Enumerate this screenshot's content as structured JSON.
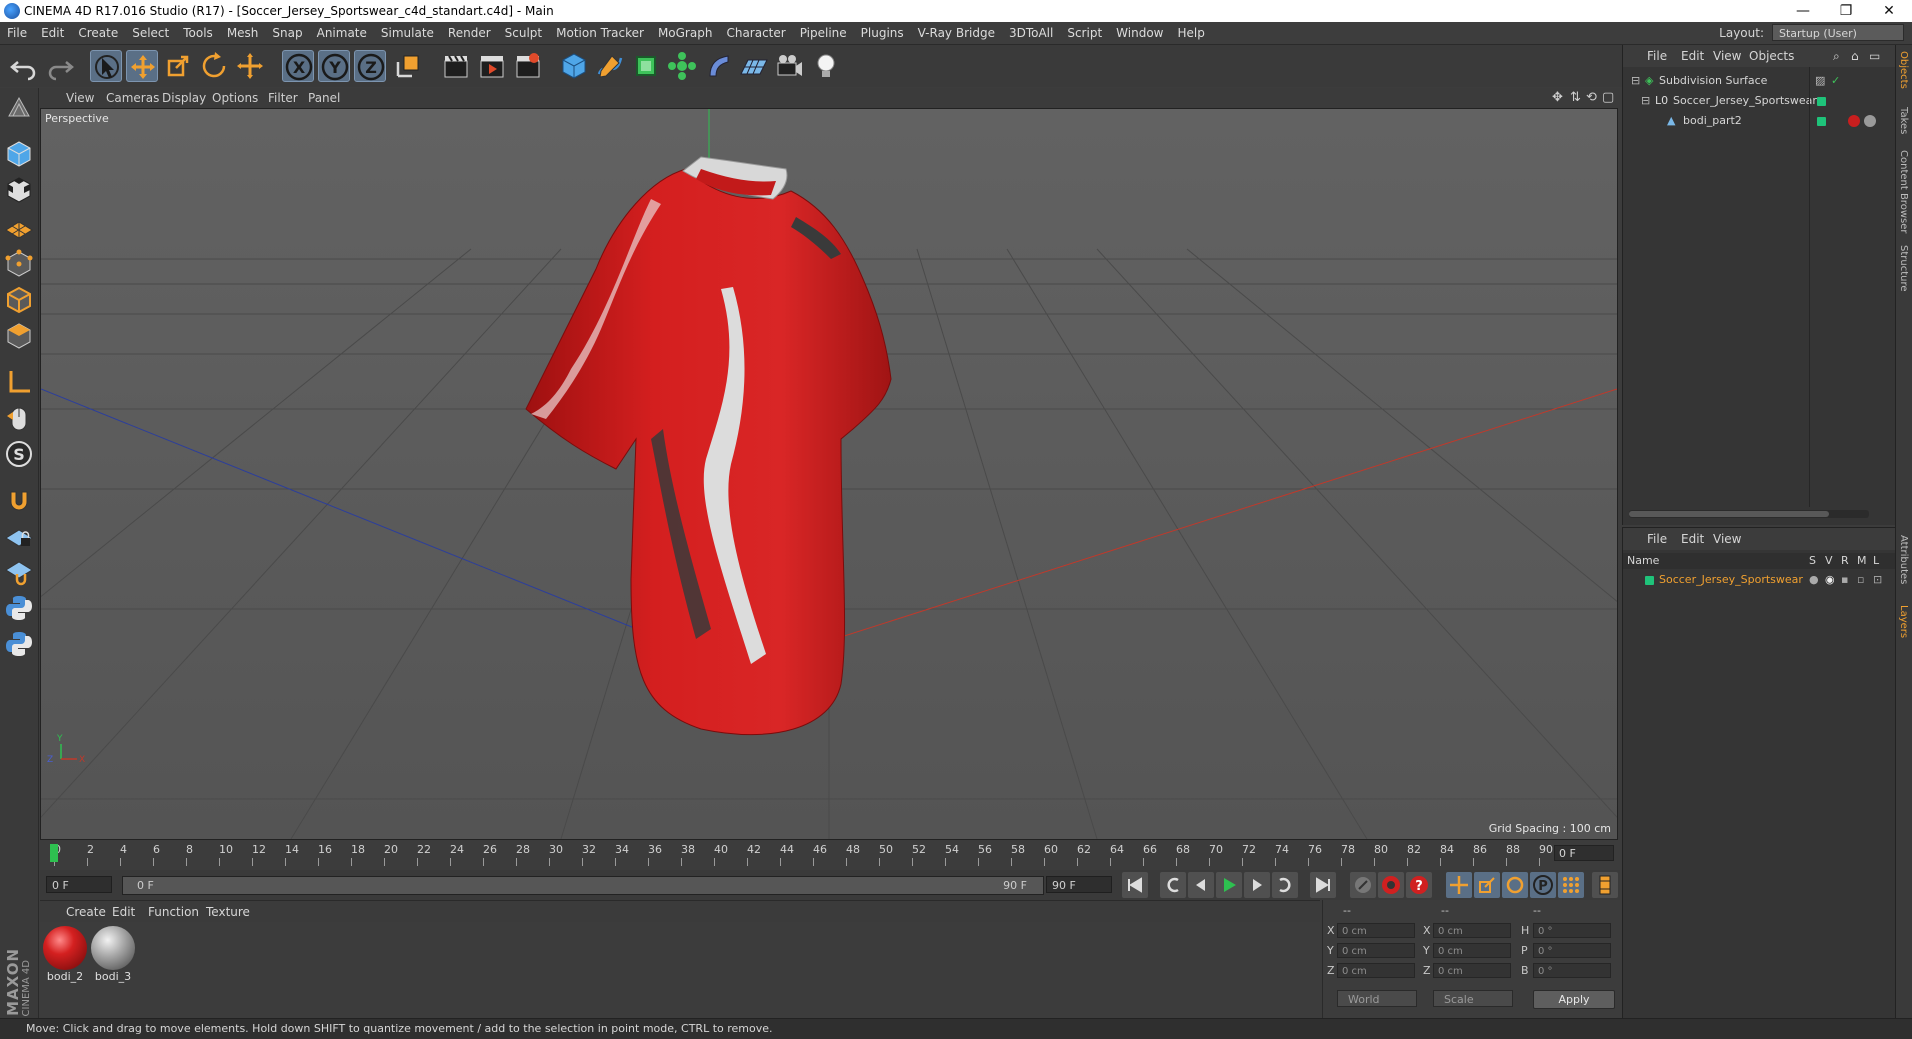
{
  "window": {
    "title": "CINEMA 4D R17.016 Studio (R17) - [Soccer_Jersey_Sportswear_c4d_standart.c4d] - Main",
    "controls": [
      "—",
      "❐",
      "✕"
    ]
  },
  "menu": [
    "File",
    "Edit",
    "Create",
    "Select",
    "Tools",
    "Mesh",
    "Snap",
    "Animate",
    "Simulate",
    "Render",
    "Sculpt",
    "Motion Tracker",
    "MoGraph",
    "Character",
    "Pipeline",
    "Plugins",
    "V-Ray Bridge",
    "3DToAll",
    "Script",
    "Window",
    "Help"
  ],
  "layout": {
    "label": "Layout:",
    "value": "Startup (User)"
  },
  "viewport": {
    "menu": [
      "View",
      "Cameras",
      "Display",
      "Options",
      "Filter",
      "Panel"
    ],
    "label": "Perspective",
    "grid_spacing": "Grid Spacing : 100 cm",
    "colors": {
      "background": "#5a5a5a",
      "jersey": "#d41f1f",
      "x_axis": "#c0392b",
      "z_axis": "#2c3e9b"
    }
  },
  "timeline": {
    "ticks": [
      "0",
      "2",
      "4",
      "6",
      "8",
      "10",
      "12",
      "14",
      "16",
      "18",
      "20",
      "22",
      "24",
      "26",
      "28",
      "30",
      "32",
      "34",
      "36",
      "38",
      "40",
      "42",
      "44",
      "46",
      "48",
      "50",
      "52",
      "54",
      "56",
      "58",
      "60",
      "62",
      "64",
      "66",
      "68",
      "70",
      "72",
      "74",
      "76",
      "78",
      "80",
      "82",
      "84",
      "86",
      "88",
      "90"
    ],
    "current_frame": "0 F",
    "start": "0 F",
    "range_start": "0 F",
    "range_end": "90 F",
    "end": "90 F"
  },
  "materials": {
    "menu": [
      "Create",
      "Edit",
      "Function",
      "Texture"
    ],
    "items": [
      {
        "label": "bodi_2",
        "color": "#c81e1e"
      },
      {
        "label": "bodi_3",
        "color": "#9a9a9a"
      }
    ]
  },
  "coordinates": {
    "headers": [
      "--",
      "--",
      "--"
    ],
    "rows": [
      {
        "a_label": "X",
        "a_value": "0 cm",
        "b_label": "X",
        "b_value": "0 cm",
        "c_label": "H",
        "c_value": "0 °"
      },
      {
        "a_label": "Y",
        "a_value": "0 cm",
        "b_label": "Y",
        "b_value": "0 cm",
        "c_label": "P",
        "c_value": "0 °"
      },
      {
        "a_label": "Z",
        "a_value": "0 cm",
        "b_label": "Z",
        "b_value": "0 cm",
        "c_label": "B",
        "c_value": "0 °"
      }
    ],
    "world": "World",
    "scale": "Scale",
    "apply": "Apply"
  },
  "objects": {
    "menu": [
      "File",
      "Edit",
      "View",
      "Objects"
    ],
    "items": [
      {
        "name": "Subdivision Surface"
      },
      {
        "name": "Soccer_Jersey_Sportswear"
      },
      {
        "name": "bodi_part2"
      }
    ]
  },
  "attributes": {
    "menu": [
      "File",
      "Edit",
      "View"
    ],
    "columns": [
      "Name",
      "S",
      "V",
      "R",
      "M",
      "L"
    ],
    "layer": "Soccer_Jersey_Sportswear"
  },
  "right_tabs": [
    "Objects",
    "Takes",
    "Content Browser",
    "Structure",
    "Attributes",
    "Layers"
  ],
  "logo": {
    "top": "MAXON",
    "bottom": "CINEMA 4D"
  },
  "status": "Move: Click and drag to move elements. Hold down SHIFT to quantize movement / add to the selection in point mode, CTRL to remove."
}
